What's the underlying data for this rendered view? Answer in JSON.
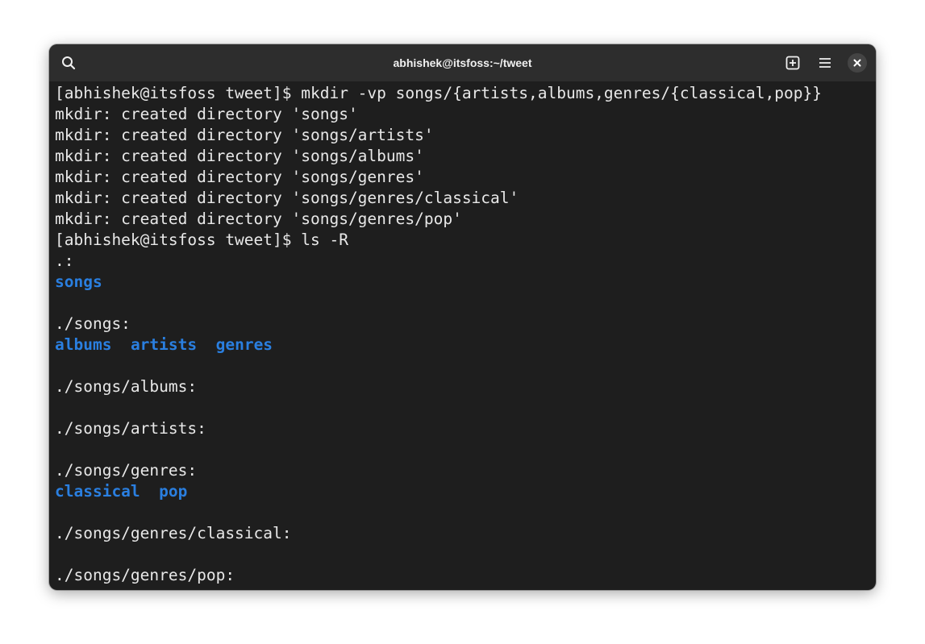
{
  "window": {
    "title": "abhishek@itsfoss:~/tweet"
  },
  "toolbar": {
    "search_icon": "search-icon",
    "new_tab_icon": "new-tab-icon",
    "menu_icon": "hamburger-menu-icon",
    "close_icon": "close-icon"
  },
  "colors": {
    "background": "#1e1e1e",
    "titlebar": "#2d2d2d",
    "text": "#e8e8e8",
    "directory": "#2a7fe0"
  },
  "terminal": {
    "lines": [
      {
        "text": "[abhishek@itsfoss tweet]$ mkdir -vp songs/{artists,albums,genres/{classical,pop}}"
      },
      {
        "text": "mkdir: created directory 'songs'"
      },
      {
        "text": "mkdir: created directory 'songs/artists'"
      },
      {
        "text": "mkdir: created directory 'songs/albums'"
      },
      {
        "text": "mkdir: created directory 'songs/genres'"
      },
      {
        "text": "mkdir: created directory 'songs/genres/classical'"
      },
      {
        "text": "mkdir: created directory 'songs/genres/pop'"
      },
      {
        "text": "[abhishek@itsfoss tweet]$ ls -R"
      },
      {
        "text": ".:"
      },
      {
        "dirs": [
          "songs"
        ]
      },
      {
        "text": ""
      },
      {
        "text": "./songs:"
      },
      {
        "dirs": [
          "albums",
          "artists",
          "genres"
        ]
      },
      {
        "text": ""
      },
      {
        "text": "./songs/albums:"
      },
      {
        "text": ""
      },
      {
        "text": "./songs/artists:"
      },
      {
        "text": ""
      },
      {
        "text": "./songs/genres:"
      },
      {
        "dirs": [
          "classical",
          "pop"
        ]
      },
      {
        "text": ""
      },
      {
        "text": "./songs/genres/classical:"
      },
      {
        "text": ""
      },
      {
        "text": "./songs/genres/pop:"
      }
    ]
  }
}
